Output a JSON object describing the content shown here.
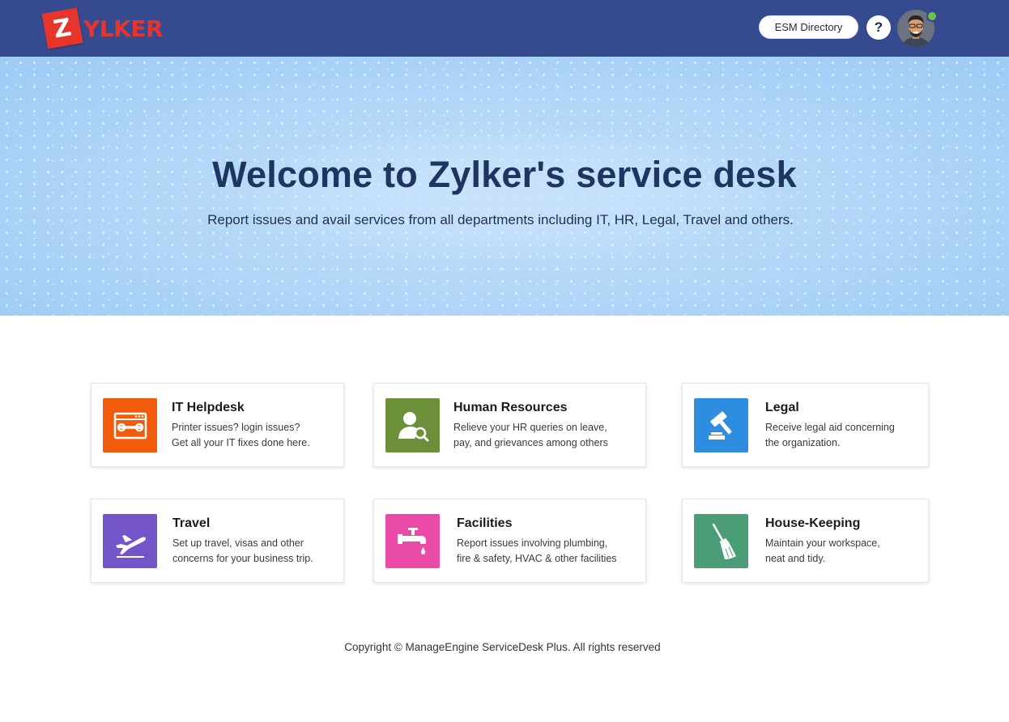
{
  "header": {
    "logo_letter": "Z",
    "logo_rest": "YLKER",
    "esm_button_label": "ESM Directory",
    "help_label": "?",
    "status_color": "#6cc24a"
  },
  "hero": {
    "title": "Welcome to Zylker's service desk",
    "subtitle": "Report issues and avail services from all departments including IT, HR, Legal, Travel and others."
  },
  "services": [
    {
      "title": "IT Helpdesk",
      "desc_line1": "Printer issues? login issues?",
      "desc_line2": "Get all your IT fixes done here.",
      "icon": "tools-window-icon",
      "color": "#f25a0c"
    },
    {
      "title": "Human Resources",
      "desc_line1": "Relieve your HR queries on leave,",
      "desc_line2": "pay, and grievances among others",
      "icon": "person-search-icon",
      "color": "#6c8f3a"
    },
    {
      "title": "Legal",
      "desc_line1": "Receive legal aid concerning",
      "desc_line2": "the organization.",
      "icon": "gavel-icon",
      "color": "#2f8de0"
    },
    {
      "title": "Travel",
      "desc_line1": "Set up travel, visas and other",
      "desc_line2": "concerns for your business trip.",
      "icon": "airplane-icon",
      "color": "#7454c9"
    },
    {
      "title": "Facilities",
      "desc_line1": "Report issues involving  plumbing,",
      "desc_line2": "fire & safety, HVAC & other facilities",
      "icon": "faucet-icon",
      "color": "#ea4aa8"
    },
    {
      "title": "House-Keeping",
      "desc_line1": "Maintain your workspace,",
      "desc_line2": "neat and tidy.",
      "icon": "broom-icon",
      "color": "#4a9d77"
    }
  ],
  "footer": {
    "copyright": "Copyright © ManageEngine ServiceDesk Plus. All rights reserved"
  }
}
